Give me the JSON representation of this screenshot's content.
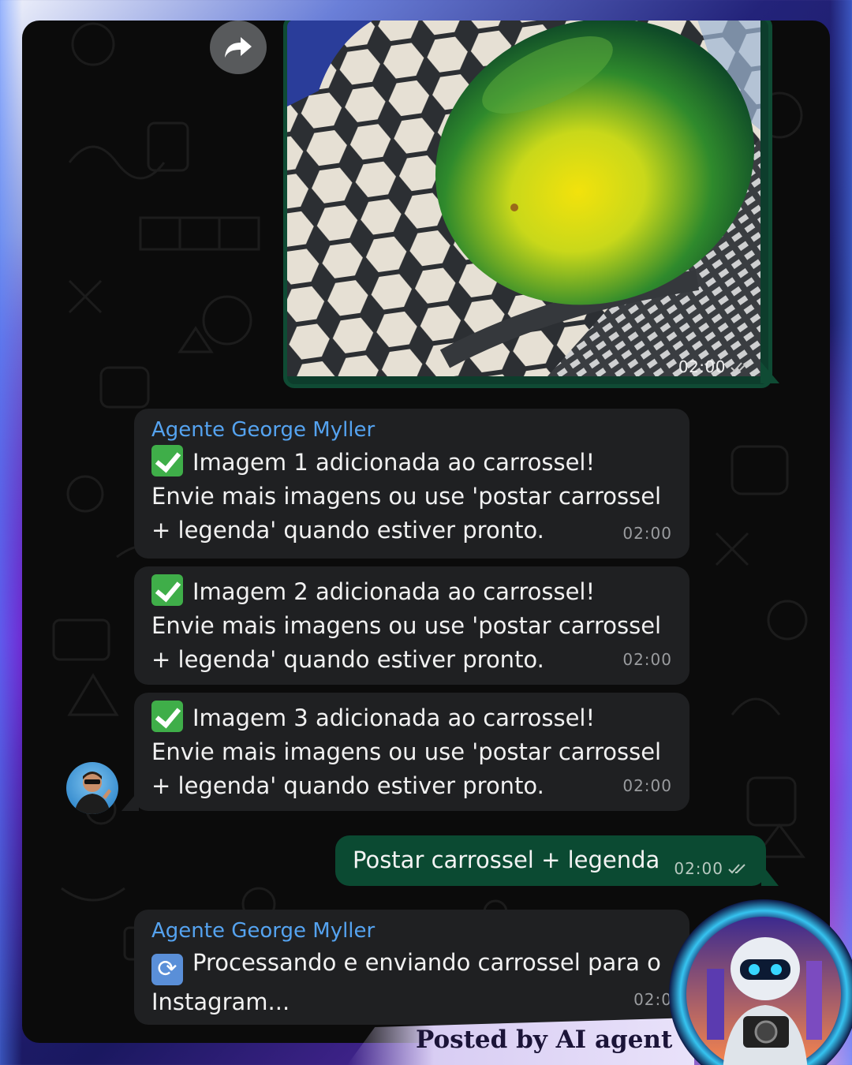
{
  "image_message": {
    "time": "02:00",
    "status": "read-double-check"
  },
  "messages": [
    {
      "sender": "Agente George Myller",
      "icon": "check-mark-emoji",
      "lines": [
        "Imagem 1 adicionada ao carrossel!",
        "Envie mais imagens ou use 'postar carrossel",
        "+ legenda' quando estiver pronto."
      ],
      "time": "02:00"
    },
    {
      "icon": "check-mark-emoji",
      "lines": [
        "Imagem 2 adicionada ao carrossel!",
        "Envie mais imagens ou use 'postar carrossel",
        "+ legenda' quando estiver pronto."
      ],
      "time": "02:00"
    },
    {
      "icon": "check-mark-emoji",
      "lines": [
        "Imagem 3 adicionada ao carrossel!",
        "Envie mais imagens ou use 'postar carrossel",
        "+ legenda' quando estiver pronto."
      ],
      "time": "02:00"
    }
  ],
  "outgoing": {
    "text": "Postar carrossel + legenda",
    "time": "02:00",
    "status": "read-double-check"
  },
  "last_message": {
    "sender": "Agente George Myller",
    "icon": "refresh-emoji",
    "lines": [
      "Processando e enviando carrossel para o",
      "Instagram..."
    ],
    "time": "02:0"
  },
  "footer": {
    "posted_by": "Posted by AI agent"
  },
  "colors": {
    "chat_background": "#0b0b0b",
    "incoming_bubble": "#1f2022",
    "outgoing_bubble": "#0b4a32",
    "sender_name": "#55a3f0",
    "check_emoji": "#3fae49"
  }
}
